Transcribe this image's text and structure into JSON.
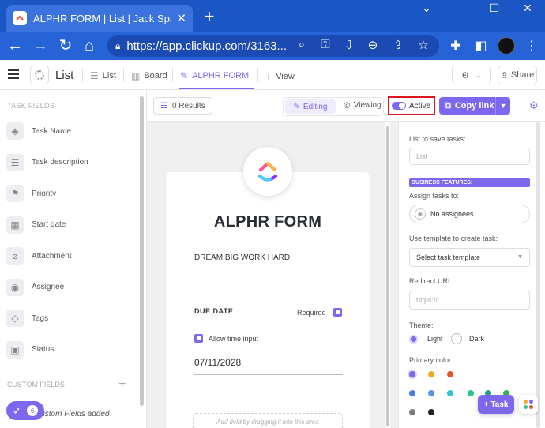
{
  "browser": {
    "tab_title": "ALPHR FORM | List | Jack Sparrow",
    "tab_close": "✕",
    "new_tab": "+",
    "url": "https://app.clickup.com/3163..."
  },
  "header": {
    "list_title": "List",
    "views": [
      {
        "label": "List",
        "icon": "list-icon"
      },
      {
        "label": "Board",
        "icon": "board-icon"
      },
      {
        "label": "ALPHR FORM",
        "icon": "form-icon"
      }
    ],
    "add_view": "View",
    "share": "Share"
  },
  "sidebar": {
    "heading": "TASK FIELDS",
    "fields": [
      {
        "label": "Task Name",
        "icon": "task-name-icon",
        "glyph": "◈"
      },
      {
        "label": "Task description",
        "icon": "description-icon",
        "glyph": "☰"
      },
      {
        "label": "Priority",
        "icon": "flag-icon",
        "glyph": "⚑"
      },
      {
        "label": "Start date",
        "icon": "calendar-icon",
        "glyph": "▦"
      },
      {
        "label": "Attachment",
        "icon": "paperclip-icon",
        "glyph": "⌀"
      },
      {
        "label": "Assignee",
        "icon": "person-icon",
        "glyph": "◉"
      },
      {
        "label": "Tags",
        "icon": "tag-icon",
        "glyph": "◇"
      },
      {
        "label": "Status",
        "icon": "status-icon",
        "glyph": "▣"
      }
    ],
    "custom_heading": "CUSTOM FIELDS",
    "custom_empty": "Custom Fields added",
    "rocket_badge": "6"
  },
  "toolbar": {
    "results": "0 Results",
    "editing": "Editing",
    "viewing": "Viewing",
    "active": "Active",
    "copy_link": "Copy link"
  },
  "form": {
    "title": "ALPHR FORM",
    "description": "DREAM BIG WORK HARD",
    "due_label": "DUE DATE",
    "required": "Required",
    "allow_time": "Allow time input",
    "date_value": "07/11/2028",
    "dropzone": "Add field by dragging it into this area"
  },
  "settings": {
    "list_label": "List to save tasks:",
    "list_value": "List",
    "business": "BUSINESS FEATURES:",
    "assign_label": "Assign tasks to:",
    "assign_value": "No assignees",
    "template_label": "Use template to create task:",
    "template_value": "Select task template",
    "redirect_label": "Redirect URL:",
    "redirect_placeholder": "https://",
    "theme_label": "Theme:",
    "light": "Light",
    "dark": "Dark",
    "primary_label": "Primary color:",
    "colors": [
      "#7b68ee",
      "#f5a623",
      "#e8542a",
      "#4a7be8",
      "#5b8ff0",
      "#2ec5d3",
      "#29c48a",
      "#2a9d8f",
      "#3bb34a",
      "#7a7a7a",
      "#222222"
    ]
  },
  "fab": {
    "task": "Task"
  }
}
